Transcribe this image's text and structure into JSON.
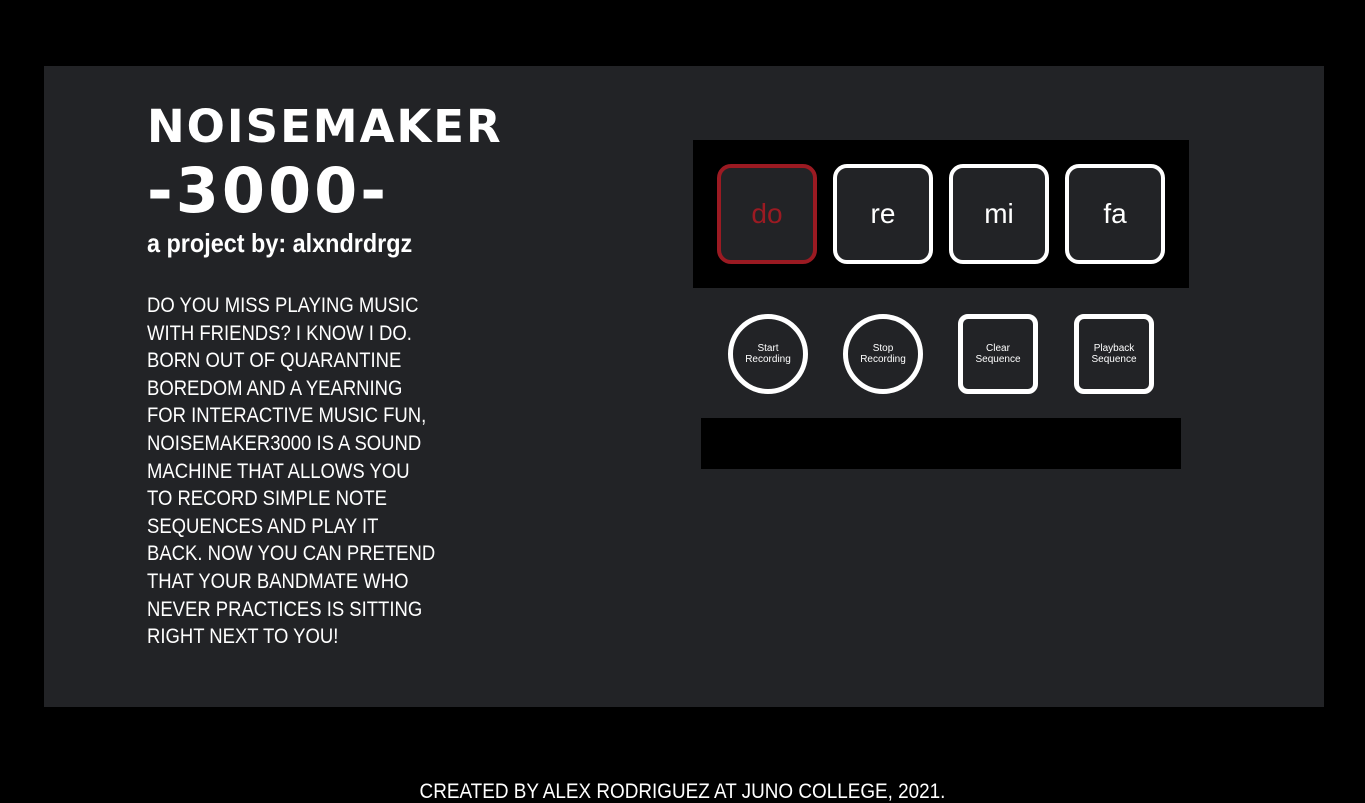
{
  "header": {
    "title": "NOISEMAKER",
    "title_number": "-3000-",
    "byline": "a project by: alxndrdrgz"
  },
  "description": "DO YOU MISS PLAYING MUSIC WITH FRIENDS? I KNOW I DO. BORN OUT OF QUARANTINE BOREDOM AND A YEARNING FOR INTERACTIVE MUSIC FUN, NOISEMAKER3000 IS A SOUND MACHINE THAT ALLOWS YOU TO RECORD SIMPLE NOTE SEQUENCES AND PLAY IT BACK. NOW YOU CAN PRETEND THAT YOUR BANDMATE WHO NEVER PRACTICES IS SITTING RIGHT NEXT TO YOU!",
  "notes": [
    {
      "label": "do",
      "active": true
    },
    {
      "label": "re",
      "active": false
    },
    {
      "label": "mi",
      "active": false
    },
    {
      "label": "fa",
      "active": false
    }
  ],
  "controls": {
    "start_line1": "Start",
    "start_line2": "Recording",
    "stop_line1": "Stop",
    "stop_line2": "Recording",
    "clear_line1": "Clear",
    "clear_line2": "Sequence",
    "playback_line1": "Playback",
    "playback_line2": "Sequence"
  },
  "sequence_display": "",
  "footer": "CREATED BY ALEX RODRIGUEZ AT JUNO COLLEGE, 2021.",
  "colors": {
    "background": "#000000",
    "panel": "#222326",
    "active_note": "#9b1a22",
    "border": "#ffffff"
  }
}
